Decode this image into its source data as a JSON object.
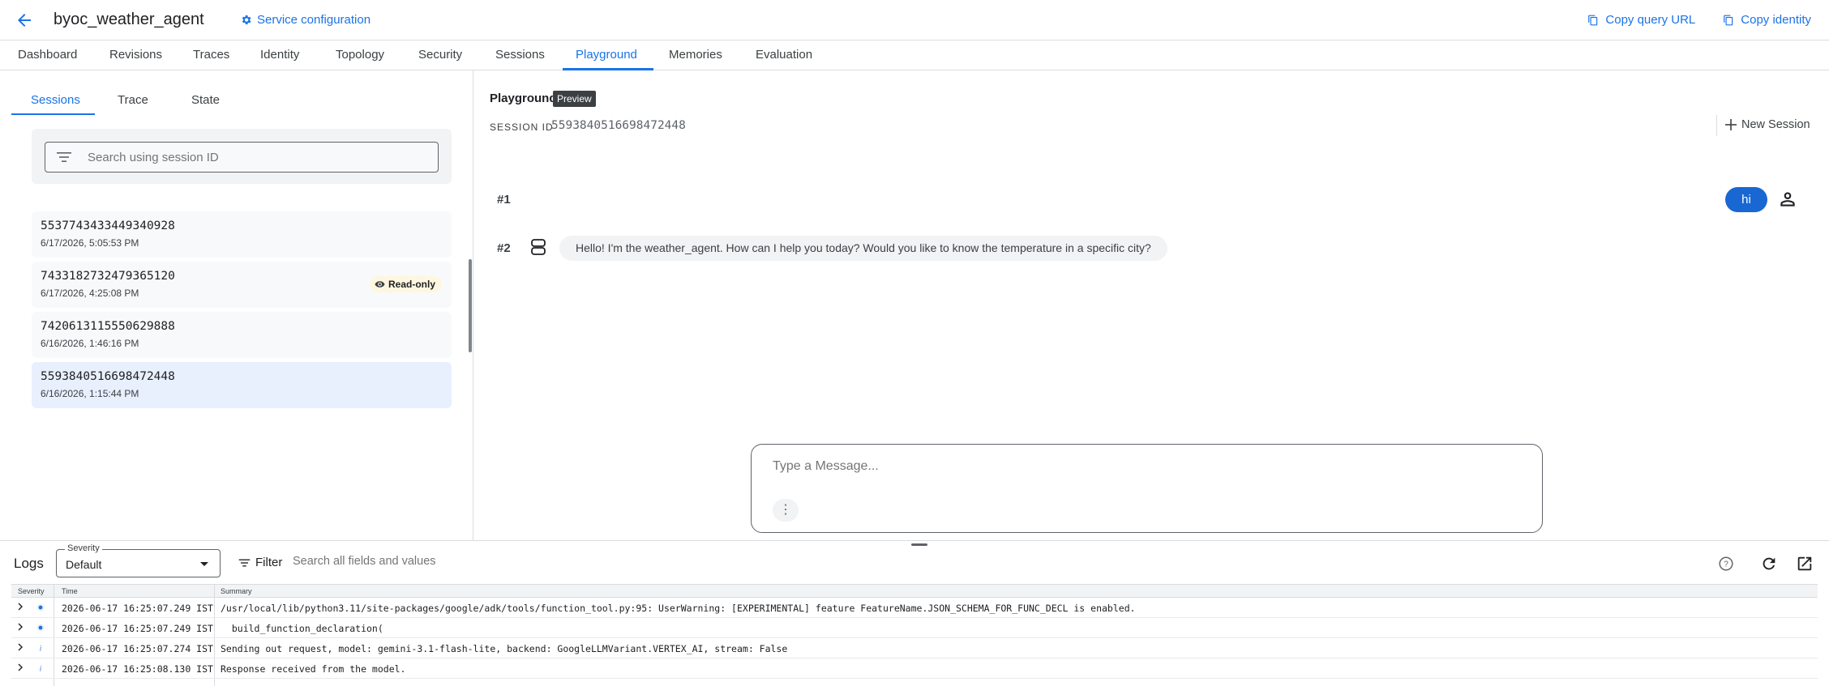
{
  "header": {
    "title": "byoc_weather_agent",
    "service_config": "Service configuration",
    "copy_query_url": "Copy query URL",
    "copy_identity": "Copy identity"
  },
  "tabs": [
    "Dashboard",
    "Revisions",
    "Traces",
    "Identity",
    "Topology",
    "Security",
    "Sessions",
    "Playground",
    "Memories",
    "Evaluation"
  ],
  "active_tab": "Playground",
  "left_panel": {
    "subtabs": [
      "Sessions",
      "Trace",
      "State"
    ],
    "active_subtab": "Sessions",
    "search_placeholder": "Search using session ID",
    "sessions": [
      {
        "id": "5537743433449340928",
        "date": "6/17/2026, 5:05:53 PM"
      },
      {
        "id": "7433182732479365120",
        "date": "6/17/2026, 4:25:08 PM",
        "badge": "Read-only"
      },
      {
        "id": "7420613115550629888",
        "date": "6/16/2026, 1:46:16 PM"
      },
      {
        "id": "5593840516698472448",
        "date": "6/16/2026, 1:15:44 PM",
        "selected": true
      }
    ]
  },
  "playground": {
    "title": "Playground",
    "badge": "Preview",
    "session_id_label": "SESSION ID",
    "session_id": "5593840516698472448",
    "new_session": "New Session",
    "turns": [
      {
        "num": "#1",
        "role": "user",
        "text": "hi"
      },
      {
        "num": "#2",
        "role": "agent",
        "text": "Hello! I'm the weather_agent. How can I help you today? Would you like to know the temperature in a specific city?"
      }
    ],
    "composer_placeholder": "Type a Message...",
    "more_glyph": "⋮"
  },
  "logs": {
    "title": "Logs",
    "severity_label": "Severity",
    "severity_value": "Default",
    "filter_label": "Filter",
    "filter_placeholder": "Search all fields and values",
    "columns": [
      "Severity",
      "Time",
      "Summary"
    ],
    "rows": [
      {
        "severity": "default",
        "time": "2026-06-17 16:25:07.249 IST",
        "summary": "/usr/local/lib/python3.11/site-packages/google/adk/tools/function_tool.py:95: UserWarning: [EXPERIMENTAL] feature FeatureName.JSON_SCHEMA_FOR_FUNC_DECL is enabled."
      },
      {
        "severity": "default",
        "time": "2026-06-17 16:25:07.249 IST",
        "summary": "  build_function_declaration("
      },
      {
        "severity": "info",
        "time": "2026-06-17 16:25:07.274 IST",
        "summary": "Sending out request, model: gemini-3.1-flash-lite, backend: GoogleLLMVariant.VERTEX_AI, stream: False"
      },
      {
        "severity": "info",
        "time": "2026-06-17 16:25:08.130 IST",
        "summary": "Response received from the model."
      }
    ]
  },
  "colors": {
    "accent": "#1a73e8",
    "user_bubble": "#1967d2",
    "selected_session": "#e8f0fe",
    "readonly_badge": "#fef7e0"
  }
}
